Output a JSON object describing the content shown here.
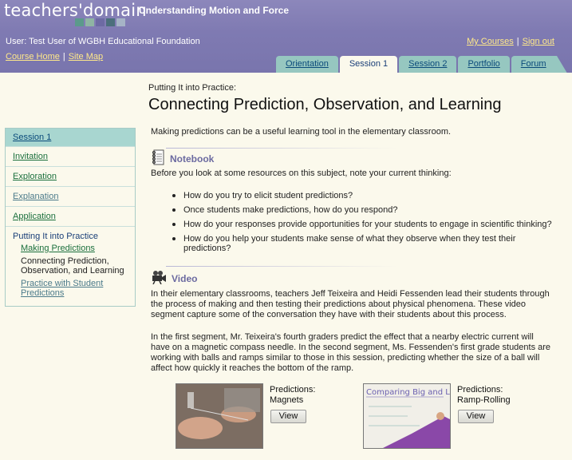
{
  "header": {
    "logo": "teachers'domain",
    "logo_square_colors": [
      "#5b9a8b",
      "#8fb5a3",
      "#6d6aa3",
      "#4c6f7c",
      "#a6b4c6"
    ],
    "course_title": "Understanding Motion and Force",
    "user_line": "User: Test User of WGBH Educational Foundation",
    "course_home": "Course Home",
    "site_map": "Site Map",
    "separator": "|",
    "my_courses": "My Courses",
    "sign_out": "Sign out"
  },
  "tabs": [
    {
      "label": "Orientation"
    },
    {
      "label": "Session 1"
    },
    {
      "label": "Session 2"
    },
    {
      "label": "Portfolio"
    },
    {
      "label": "Forum"
    }
  ],
  "sidebar": {
    "head": "Session 1",
    "items": [
      "Invitation",
      "Exploration",
      "Explanation",
      "Application"
    ],
    "section_title": "Putting It into Practice",
    "sub_items": [
      "Making Predictions",
      "Connecting Prediction, Observation, and Learning",
      "Practice with Student Predictions"
    ]
  },
  "main": {
    "breadcrumb": "Putting It into Practice:",
    "title": "Connecting Prediction, Observation, and Learning",
    "intro": "Making predictions can be a useful learning tool in the elementary classroom.",
    "notebook": {
      "label": "Notebook",
      "prompt": "Before you look at some resources on this subject, note your current thinking:",
      "questions": [
        "How do you try to elicit student predictions?",
        "Once students make predictions, how do you respond?",
        "How do your responses provide opportunities for your students to engage in scientific thinking?",
        "How do you help your students make sense of what they observe when they test their predictions?"
      ]
    },
    "video": {
      "label": "Video",
      "para1": "In their elementary classrooms, teachers Jeff Teixeira and Heidi Fessenden lead their students through the process of making and then testing their predictions about physical phenomena. These video segment capture some of the conversation they have with their students about this process.",
      "para2": "In the first segment, Mr. Teixeira's fourth graders predict the effect that a nearby electric current will have on a magnetic compass needle. In the second segment, Ms. Fessenden's first grade students are working with balls and ramps similar to those in this session, predicting whether the size of a ball will affect how quickly it reaches the bottom of the ramp."
    },
    "clips": [
      {
        "title": "Predictions:",
        "subtitle": "Magnets",
        "button": "View"
      },
      {
        "title": "Predictions:",
        "subtitle": "Ramp-Rolling",
        "button": "View",
        "board_text": "Comparing Big and Li"
      }
    ]
  }
}
